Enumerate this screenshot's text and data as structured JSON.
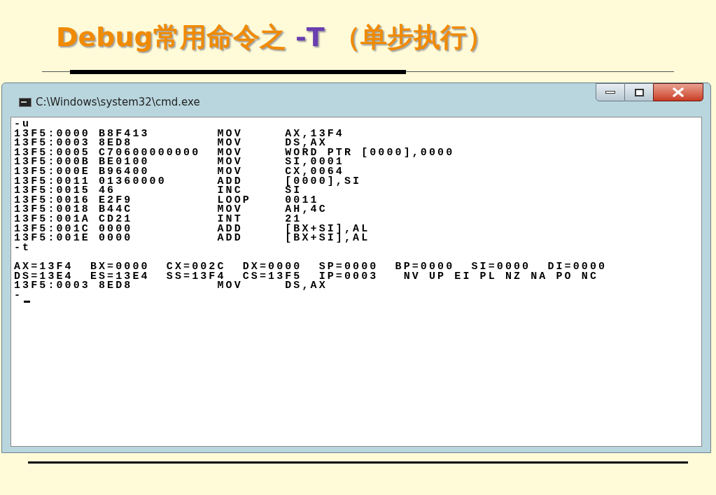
{
  "slide_title": [
    {
      "text": "Debug常用命令之 ",
      "kind": "main"
    },
    {
      "text": "-T",
      "kind": "accent"
    },
    {
      "text": " （单步执行）",
      "kind": "main"
    }
  ],
  "window": {
    "title": "C:\\Windows\\system32\\cmd.exe",
    "console": [
      {
        "lines": [
          "-u",
          "13F5:0000 B8F413        MOV     AX,13F4",
          "13F5:0003 8ED8          MOV     DS,AX",
          "13F5:0005 C70600000000  MOV     WORD PTR [0000],0000",
          "13F5:000B BE0100        MOV     SI,0001",
          "13F5:000E B96400        MOV     CX,0064",
          "13F5:0011 01360000      ADD     [0000],SI",
          "13F5:0015 46            INC     SI",
          "13F5:0016 E2F9          LOOP    0011",
          "13F5:0018 B44C          MOV     AH,4C",
          "13F5:001A CD21          INT     21",
          "13F5:001C 0000          ADD     [BX+SI],AL",
          "13F5:001E 0000          ADD     [BX+SI],AL",
          "-t"
        ]
      },
      {
        "lines": [
          "AX=13F4  BX=0000  CX=002C  DX=0000  SP=0000  BP=0000  SI=0000  DI=0000",
          "DS=13E4  ES=13E4  SS=13F4  CS=13F5  IP=0003   NV UP EI PL NZ NA PO NC",
          "13F5:0003 8ED8          MOV     DS,AX",
          "-"
        ]
      }
    ]
  }
}
